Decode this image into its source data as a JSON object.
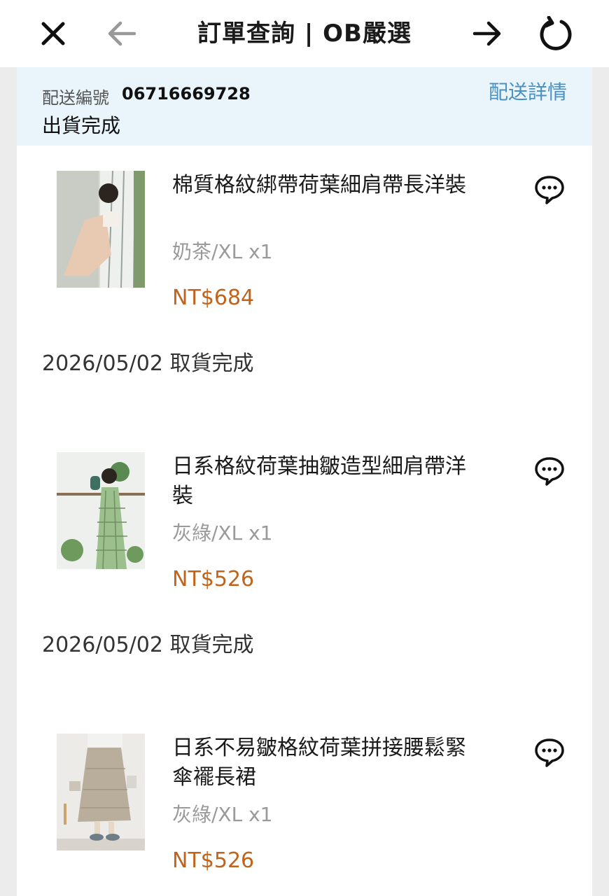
{
  "header": {
    "title": "訂單查詢 | OB嚴選",
    "close_icon": "close-icon",
    "back_icon": "arrow-left-icon",
    "forward_icon": "arrow-right-icon",
    "refresh_icon": "refresh-icon"
  },
  "shipment": {
    "label": "配送編號",
    "number": "06716669728",
    "status": "出貨完成",
    "details_link": "配送詳情"
  },
  "items": [
    {
      "name": "棉質格紋綁帶荷葉細肩帶長洋裝",
      "variant": "奶茶/XL x1",
      "price": "NT$684",
      "pickup": "2026/05/02 取貨完成"
    },
    {
      "name": "日系格紋荷葉抽皺造型細肩帶洋裝",
      "variant": "灰綠/XL x1",
      "price": "NT$526",
      "pickup": "2026/05/02 取貨完成"
    },
    {
      "name": "日系不易皺格紋荷葉拼接腰鬆緊傘襬長裙",
      "variant": "灰綠/XL x1",
      "price": "NT$526"
    }
  ],
  "colors": {
    "price": "#c0641d",
    "link": "#4a90c2",
    "header_bg": "#e9f4fb"
  }
}
